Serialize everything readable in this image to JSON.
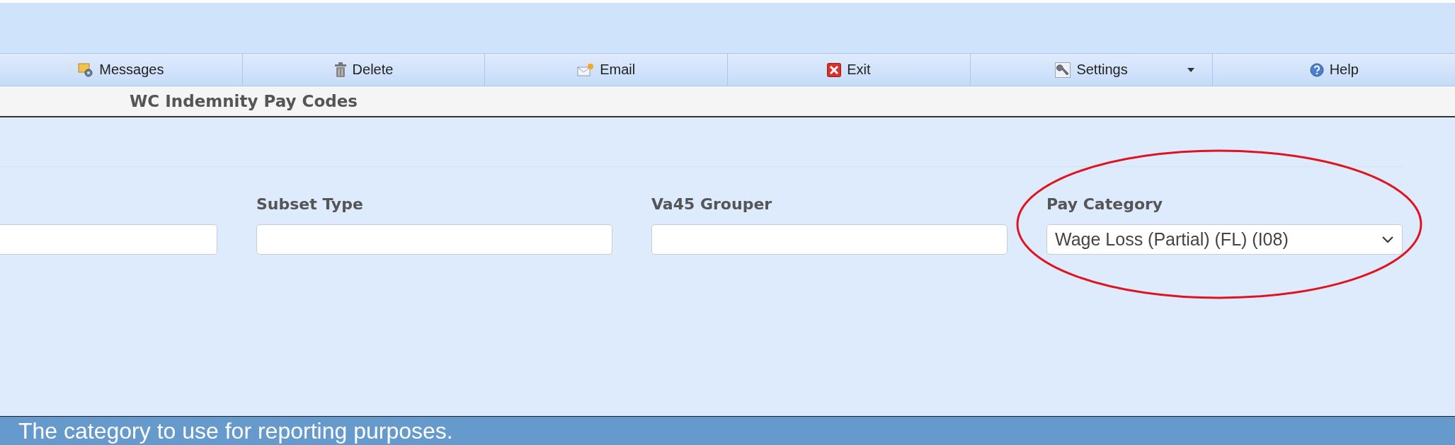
{
  "toolbar": [
    {
      "label": "Messages",
      "kind": "messages",
      "has_menu": false
    },
    {
      "label": "Delete",
      "kind": "delete",
      "has_menu": false
    },
    {
      "label": "Email",
      "kind": "email",
      "has_menu": false
    },
    {
      "label": "Exit",
      "kind": "exit",
      "has_menu": false
    },
    {
      "label": "Settings",
      "kind": "settings",
      "has_menu": true
    },
    {
      "label": "Help",
      "kind": "help",
      "has_menu": false
    }
  ],
  "page_title": "WC Indemnity Pay Codes",
  "fields": [
    {
      "kind": "text"
    },
    {
      "kind": "text",
      "label": "Subset Type"
    },
    {
      "kind": "text",
      "label": "Va45 Grouper"
    },
    {
      "kind": "select",
      "label": "Pay Category",
      "value": "Wage Loss (Partial) (FL) (I08)",
      "circled": true
    }
  ],
  "status_bar": "The category to use for reporting purposes."
}
